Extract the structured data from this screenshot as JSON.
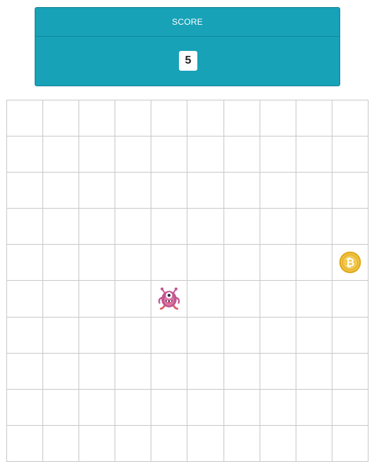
{
  "score": {
    "label": "SCORE",
    "value": "5"
  },
  "board": {
    "rows": 10,
    "cols": 10,
    "entities": [
      {
        "type": "monster",
        "icon": "pink-monster-icon",
        "row": 5,
        "col": 4
      },
      {
        "type": "coin",
        "icon": "bitcoin-coin-icon",
        "row": 4,
        "col": 9
      }
    ]
  },
  "colors": {
    "panel": "#17a2b8",
    "grid_line": "#c8c8c8",
    "coin": "#f2c94c",
    "monster": "#c2568f"
  }
}
